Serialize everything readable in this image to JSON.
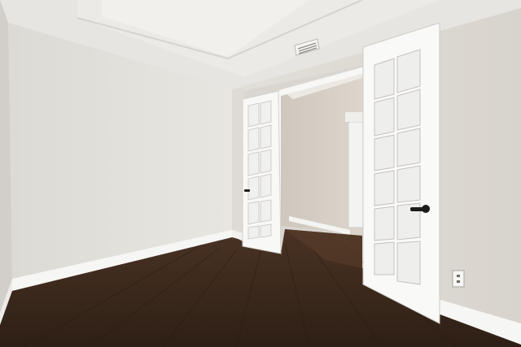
{
  "scene": {
    "subject": "empty room",
    "colors": {
      "wall_left": "#e6e4df",
      "wall_back": "#dddad4",
      "wall_right": "#e3e0da",
      "ceiling": "#ebe9e5",
      "tray_ceiling": "#f1efec",
      "floor": "#3a271b",
      "floor_light": "#5a3d2a",
      "trim": "#f6f6f4",
      "door_glass": "#f2f2f2",
      "hall_wall": "#d4cdc4",
      "hardware": "#1c1c1c"
    },
    "icons": [
      "air-vent-icon",
      "door-handle-icon",
      "wall-outlet-icon"
    ]
  }
}
